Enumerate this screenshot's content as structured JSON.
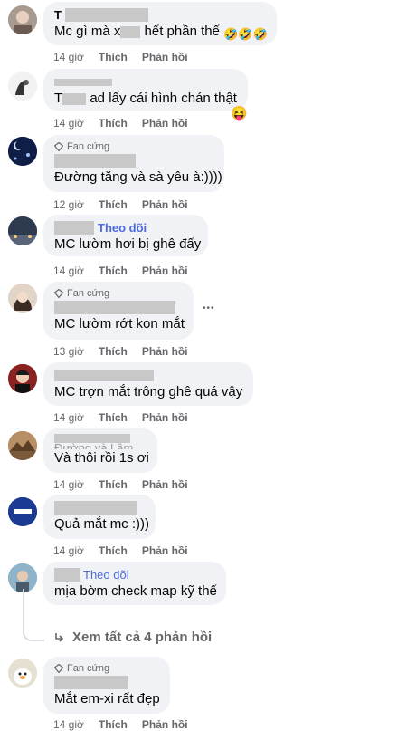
{
  "actions": {
    "like": "Thích",
    "reply": "Phản hồi"
  },
  "badge_fan": "Fan cứng",
  "follow_label": "Theo dõi",
  "comments": [
    {
      "name_prefix": "T",
      "text_a": "Mc gì mà x",
      "text_b": " hết phần thế",
      "emoji": "🤣🤣🤣",
      "time": "14 giờ"
    },
    {
      "name_prefix": "",
      "text_a": "T",
      "text_b": " ad lấy cái hình chán thật",
      "emoji": "😝",
      "time": "14 giờ"
    },
    {
      "badge": "Fan cứng",
      "text": "Đường tăng và sà yêu à:))))",
      "time": "12 giờ"
    },
    {
      "follow": "Theo dõi",
      "text": "MC lườm hơi bị ghê đấy",
      "time": "14 giờ"
    },
    {
      "badge": "Fan cứng",
      "text": "MC lườm rớt kon mắt",
      "time": "13 giờ"
    },
    {
      "text": "MC trợn mắt trông ghê quá vậy",
      "time": "14 giờ"
    },
    {
      "text_top": "Đường và Lâm",
      "text": "Và thôi rồi 1s ơi",
      "time": "14 giờ"
    },
    {
      "text": "Quả mắt mc :)))",
      "time": "14 giờ"
    },
    {
      "follow": "Theo dõi",
      "text": "mịa bờm check map kỹ thế",
      "time": "14 giờ"
    },
    {
      "badge": "Fan cứng",
      "text": "Mắt em-xi rất đẹp",
      "time": "14 giờ"
    }
  ],
  "view_all": "Xem tất cả 4 phản hồi",
  "more": "•••"
}
